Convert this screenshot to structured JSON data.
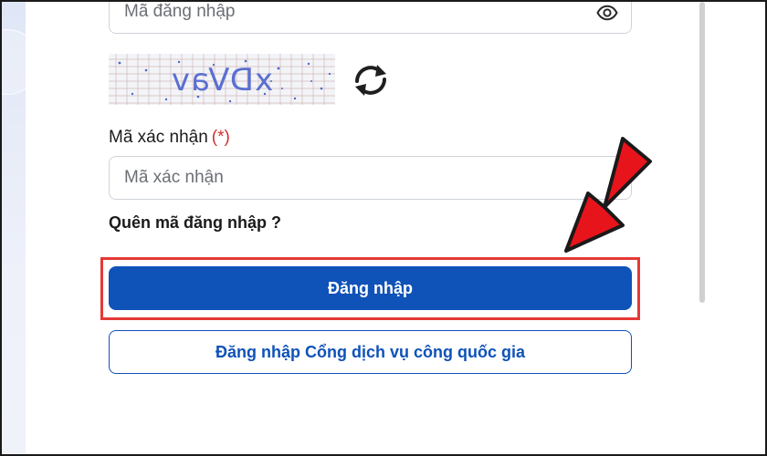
{
  "login_form": {
    "username_placeholder": "Mã đăng nhập",
    "captcha_text": "xDVav",
    "captcha_label": "Mã xác nhận",
    "required_mark": "(*)",
    "captcha_placeholder": "Mã xác nhận",
    "forgot_link": "Quên mã đăng nhập ?",
    "login_button": "Đăng nhập",
    "gov_login_button": "Đăng nhập Cổng dịch vụ công quốc gia"
  },
  "colors": {
    "primary": "#0f52b8",
    "highlight": "#e53935",
    "arrow": "#e8141c",
    "required": "#d32f2f"
  },
  "icons": [
    "eye-icon",
    "refresh-icon",
    "pointer-arrow-icon"
  ]
}
